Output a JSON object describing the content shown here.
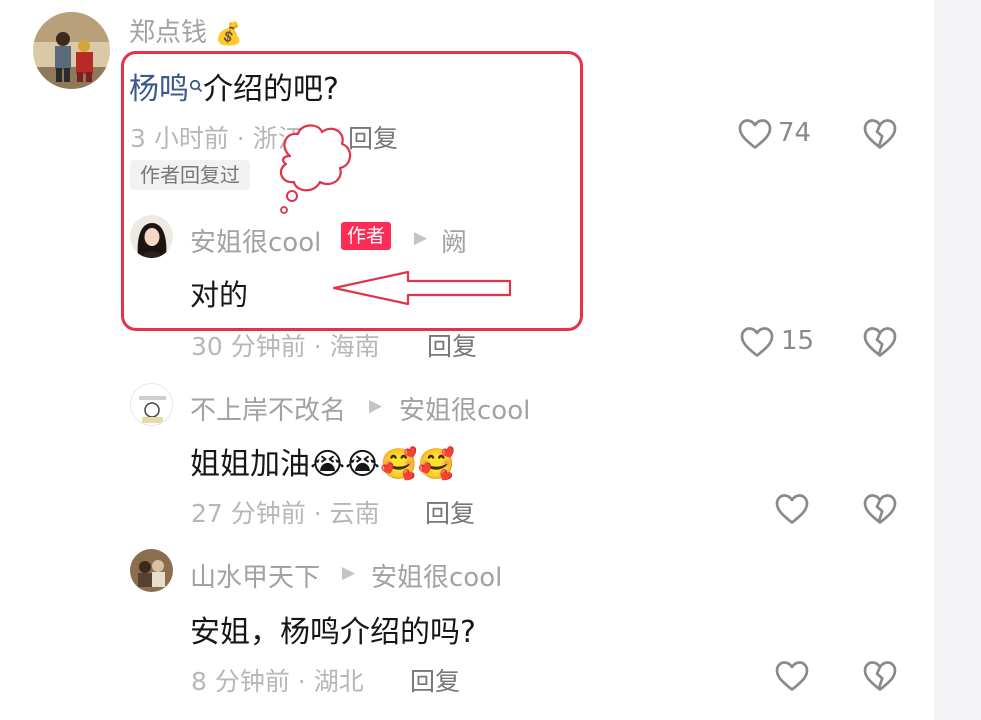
{
  "comments": [
    {
      "username": "郑点钱",
      "username_emoji": "💰",
      "mention": "杨鸣",
      "text": "介绍的吧?",
      "meta": "3 小时前 · 浙江",
      "reply_label": "回复",
      "like_count": "74",
      "author_replied_tag": "作者回复过"
    }
  ],
  "replies": [
    {
      "username": "安姐很cool",
      "badge": "作者",
      "reply_to": "阙",
      "text": "对的",
      "meta": "30 分钟前 · 海南",
      "reply_label": "回复",
      "like_count": "15"
    },
    {
      "username": "不上岸不改名",
      "reply_to": "安姐很cool",
      "text": "姐姐加油",
      "emojis": "😭😭🥰🥰",
      "meta": "27 分钟前 · 云南",
      "reply_label": "回复",
      "like_count": ""
    },
    {
      "username": "山水甲天下",
      "reply_to": "安姐很cool",
      "text": "安姐，杨鸣介绍的吗?",
      "meta": "8 分钟前 · 湖北",
      "reply_label": "回复",
      "like_count": ""
    }
  ],
  "colors": {
    "annotation_red": "#e1334a",
    "author_badge": "#fe2c55",
    "mention": "#3b5a8a"
  },
  "icons": {
    "like": "heart-outline-icon",
    "dislike": "broken-heart-icon",
    "reply_arrow": "triangle-right-icon"
  }
}
